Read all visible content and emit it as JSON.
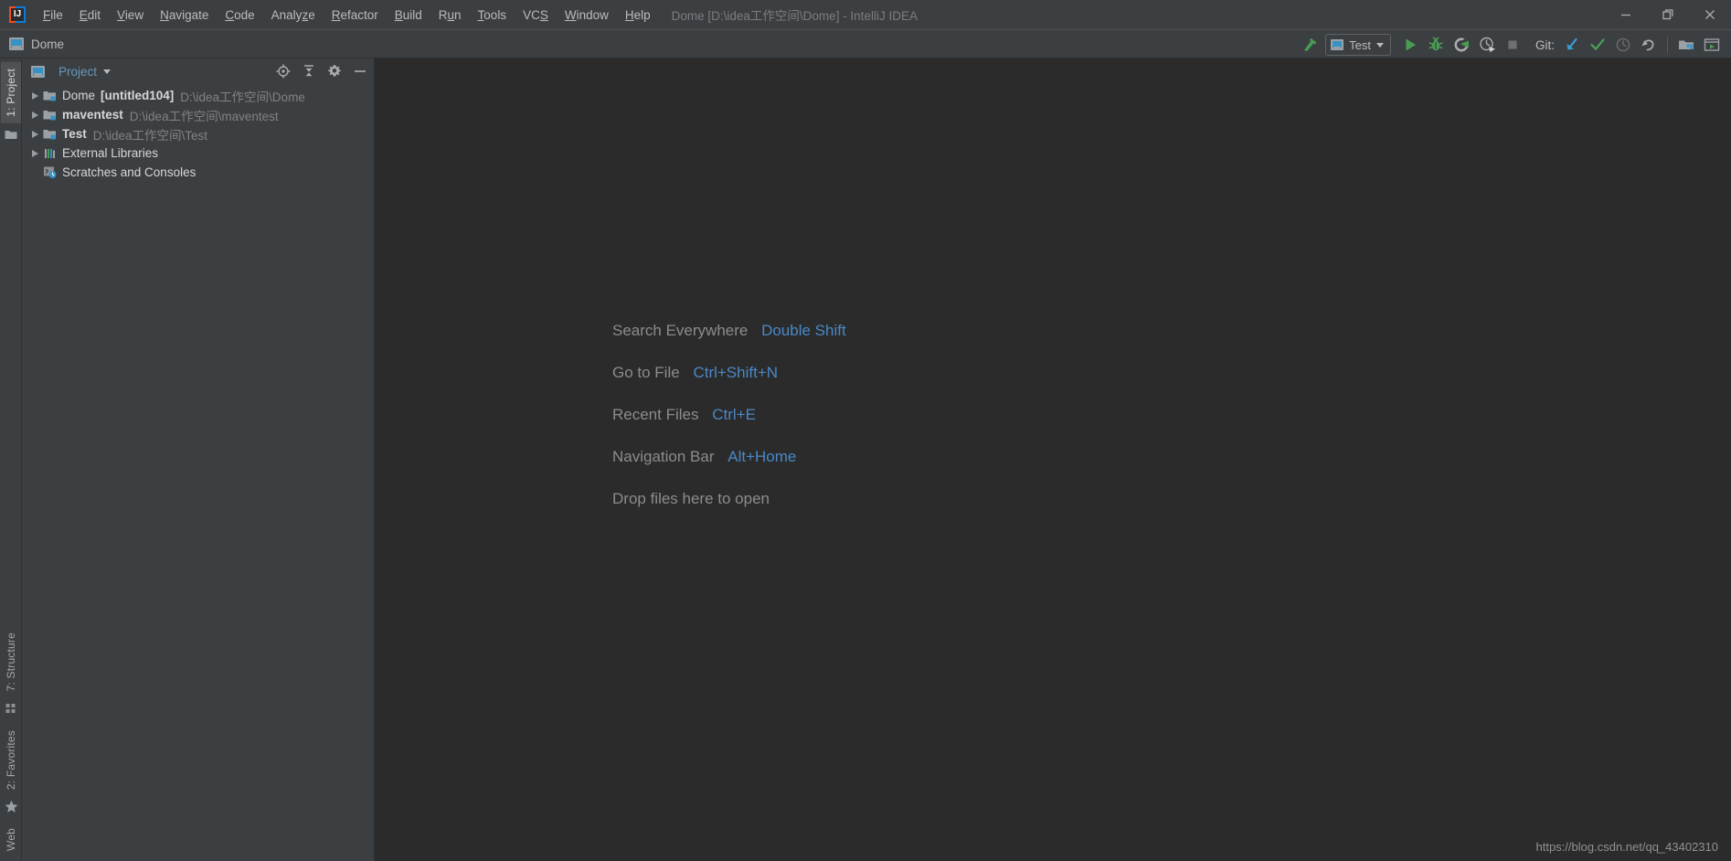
{
  "window": {
    "title": "Dome [D:\\idea工作空间\\Dome] - IntelliJ IDEA",
    "minimize_label": "Minimize",
    "restore_label": "Restore",
    "close_label": "Close"
  },
  "menu": {
    "items": [
      {
        "label": "File",
        "mnemonic": "F"
      },
      {
        "label": "Edit",
        "mnemonic": "E"
      },
      {
        "label": "View",
        "mnemonic": "V"
      },
      {
        "label": "Navigate",
        "mnemonic": "N"
      },
      {
        "label": "Code",
        "mnemonic": "C"
      },
      {
        "label": "Analyze",
        "mnemonic": "z"
      },
      {
        "label": "Refactor",
        "mnemonic": "R"
      },
      {
        "label": "Build",
        "mnemonic": "B"
      },
      {
        "label": "Run",
        "mnemonic": "u"
      },
      {
        "label": "Tools",
        "mnemonic": "T"
      },
      {
        "label": "VCS",
        "mnemonic": "S"
      },
      {
        "label": "Window",
        "mnemonic": "W"
      },
      {
        "label": "Help",
        "mnemonic": "H"
      }
    ]
  },
  "toolbar": {
    "navbar_item": "Dome",
    "navbar_icon": "module-icon",
    "build_label": "Build Project",
    "build_icon": "hammer-icon",
    "run_config": "Test",
    "run_config_icon": "module-icon",
    "run_label": "Run",
    "debug_label": "Debug",
    "run_coverage_label": "Run with Coverage",
    "profiler_label": "Profiler",
    "stop_label": "Stop",
    "git_label": "Git:",
    "git_update_label": "Update Project",
    "git_commit_label": "Commit",
    "git_history_label": "Show History",
    "git_rollback_label": "Rollback",
    "structure_settings_label": "Project Structure",
    "run_window_label": "Open Run Window"
  },
  "stripe": {
    "left_top": [
      {
        "label": "1: Project",
        "active": true,
        "icon": "project-icon"
      }
    ],
    "left_bottom": [
      {
        "label": "7: Structure",
        "icon": "structure-icon"
      },
      {
        "label": "2: Favorites",
        "icon": "star-icon"
      },
      {
        "label": "Web",
        "icon": "web-icon"
      }
    ]
  },
  "project_panel": {
    "title": "Project",
    "title_icon": "project-icon",
    "actions": [
      {
        "name": "locate-icon",
        "label": "Select Opened File"
      },
      {
        "name": "collapse-all-icon",
        "label": "Collapse All"
      },
      {
        "name": "gear-icon",
        "label": "Settings"
      },
      {
        "name": "hide-icon",
        "label": "Hide"
      }
    ],
    "tree": [
      {
        "name": "Dome",
        "tag": "[untitled104]",
        "path": "D:\\idea工作空间\\Dome",
        "icon": "module-folder-icon",
        "expandable": true,
        "indent": 0
      },
      {
        "name": "maventest",
        "tag": "",
        "path": "D:\\idea工作空间\\maventest",
        "icon": "module-folder-icon",
        "expandable": true,
        "indent": 0
      },
      {
        "name": "Test",
        "tag": "",
        "path": "D:\\idea工作空间\\Test",
        "icon": "module-folder-icon",
        "expandable": true,
        "indent": 0
      },
      {
        "name": "External Libraries",
        "tag": "",
        "path": "",
        "icon": "libraries-icon",
        "expandable": true,
        "indent": 0
      },
      {
        "name": "Scratches and Consoles",
        "tag": "",
        "path": "",
        "icon": "scratches-icon",
        "expandable": false,
        "indent": 0
      }
    ]
  },
  "editor": {
    "tips": [
      {
        "label": "Search Everywhere",
        "key": "Double Shift"
      },
      {
        "label": "Go to File",
        "key": "Ctrl+Shift+N"
      },
      {
        "label": "Recent Files",
        "key": "Ctrl+E"
      },
      {
        "label": "Navigation Bar",
        "key": "Alt+Home"
      },
      {
        "label": "Drop files here to open",
        "key": ""
      }
    ],
    "watermark": "https://blog.csdn.net/qq_43402310"
  },
  "colors": {
    "accent_blue": "#4a88c7",
    "panel_title_blue": "#6897BB",
    "green": "#499C54",
    "git_blue": "#389FD6",
    "chrome": "#3c3f41",
    "editor_bg": "#2b2b2b"
  }
}
